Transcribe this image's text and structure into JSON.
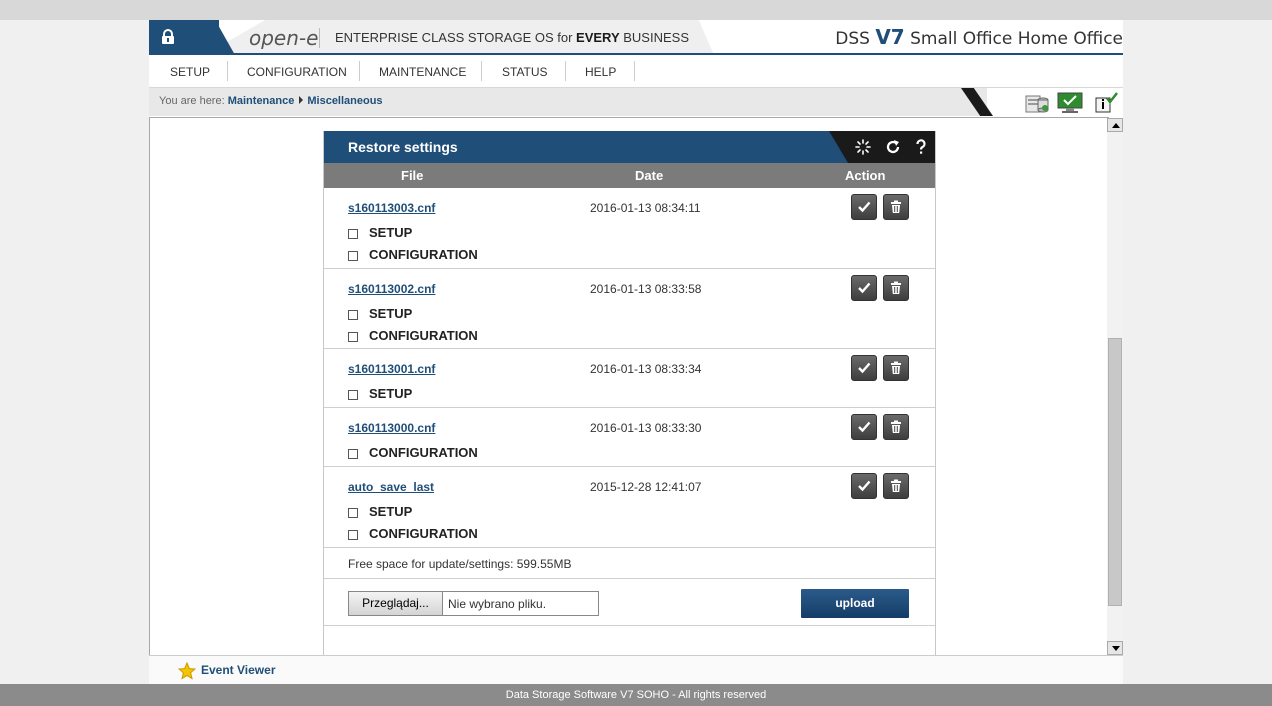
{
  "header": {
    "logo": "open-e",
    "tagline_pre": "ENTERPRISE CLASS STORAGE OS for ",
    "tagline_bold": "EVERY",
    "tagline_post": " BUSINESS",
    "product_pre": "DSS ",
    "product_version": "V7",
    "product_post": " Small Office Home Office"
  },
  "menu": [
    "SETUP",
    "CONFIGURATION",
    "MAINTENANCE",
    "STATUS",
    "HELP"
  ],
  "breadcrumb": {
    "prefix": "You are here:",
    "items": [
      "Maintenance",
      "Miscellaneous"
    ]
  },
  "panel": {
    "title": "Restore settings",
    "columns": {
      "file": "File",
      "date": "Date",
      "action": "Action"
    },
    "rows": [
      {
        "file": "s160113003.cnf",
        "date": "2016-01-13 08:34:11",
        "options": [
          "SETUP",
          "CONFIGURATION"
        ]
      },
      {
        "file": "s160113002.cnf",
        "date": "2016-01-13 08:33:58",
        "options": [
          "SETUP",
          "CONFIGURATION"
        ]
      },
      {
        "file": "s160113001.cnf",
        "date": "2016-01-13 08:33:34",
        "options": [
          "SETUP"
        ]
      },
      {
        "file": "s160113000.cnf",
        "date": "2016-01-13 08:33:30",
        "options": [
          "CONFIGURATION"
        ]
      },
      {
        "file": "auto_save_last",
        "date": "2015-12-28 12:41:07",
        "options": [
          "SETUP",
          "CONFIGURATION"
        ]
      }
    ],
    "free_space": "Free space for update/settings: 599.55MB",
    "browse_label": "Przeglądaj...",
    "no_file_label": "Nie wybrano pliku.",
    "upload_label": "upload"
  },
  "footer": {
    "event_viewer": "Event Viewer",
    "copyright": "Data Storage Software V7 SOHO - All rights reserved"
  },
  "colors": {
    "brand_blue": "#1f4e79",
    "dark": "#1a1a1a",
    "header_gray": "#7b7b7b"
  }
}
